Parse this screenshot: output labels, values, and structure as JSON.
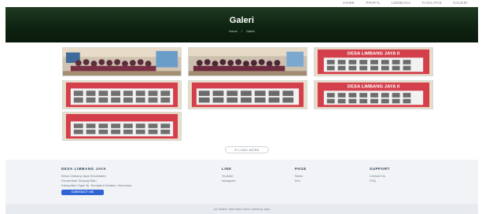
{
  "nav": {
    "items": [
      "Home",
      "Profil",
      "Lembaga",
      "Fasilitas",
      "Galeri"
    ]
  },
  "hero": {
    "title": "Galeri",
    "breadcrumb_home": "Home",
    "breadcrumb_sep": "/",
    "breadcrumb_current": "Galeri"
  },
  "gallery": {
    "items": [
      {
        "alt": "group-photo"
      },
      {
        "alt": "group-photo"
      },
      {
        "alt": "banner",
        "caption": "DESA LIMBANG JAYA II"
      },
      {
        "alt": "banner"
      },
      {
        "alt": "banner"
      },
      {
        "alt": "banner",
        "caption": "DESA LIMBANG JAYA II"
      },
      {
        "alt": "banner"
      }
    ]
  },
  "load_more": {
    "label": "⟳ LOAD MORE"
  },
  "footer": {
    "brand": "DESA LIMBANG JAYA",
    "address_1": "Desa Limbang Jaya Kecamatan",
    "address_2": "Kecamatan Tanjung Batu",
    "address_3": "Kabupaten Ogan Ilir, Sumatera Selatan, Indonesia",
    "contact_button": "Contact Us",
    "link_title": "Link",
    "link_items": [
      "Youtube",
      "Instagram"
    ],
    "page_title": "Page",
    "page_items": [
      "News",
      "Info"
    ],
    "support_title": "Support",
    "support_items": [
      "Contact Us",
      "FAQ"
    ],
    "copyright": "(c) Sistem Informasi Desa Limbang Jaya"
  },
  "colors": {
    "hero_dark": "#0f2412",
    "accent": "#2f63d6",
    "banner_red": "#d33f4b"
  }
}
